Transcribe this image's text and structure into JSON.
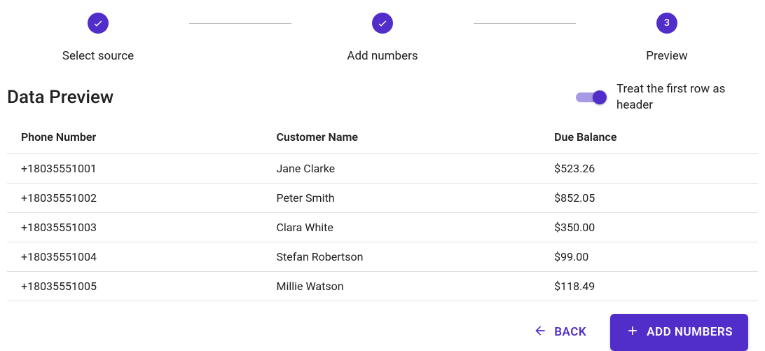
{
  "stepper": {
    "steps": [
      {
        "label": "Select source",
        "done": true
      },
      {
        "label": "Add numbers",
        "done": true
      },
      {
        "label": "Preview",
        "done": false,
        "num": "3"
      }
    ]
  },
  "heading": "Data Preview",
  "toggle": {
    "on": true,
    "label": "Treat the first row as header"
  },
  "table": {
    "headers": [
      "Phone Number",
      "Customer Name",
      "Due Balance"
    ],
    "rows": [
      {
        "phone": "+18035551001",
        "name": "Jane Clarke",
        "due": "$523.26"
      },
      {
        "phone": "+18035551002",
        "name": "Peter Smith",
        "due": "$852.05"
      },
      {
        "phone": "+18035551003",
        "name": "Clara White",
        "due": "$350.00"
      },
      {
        "phone": "+18035551004",
        "name": "Stefan Robertson",
        "due": "$99.00"
      },
      {
        "phone": "+18035551005",
        "name": "Millie Watson",
        "due": "$118.49"
      }
    ]
  },
  "footer": {
    "back": "BACK",
    "add": "ADD NUMBERS"
  }
}
